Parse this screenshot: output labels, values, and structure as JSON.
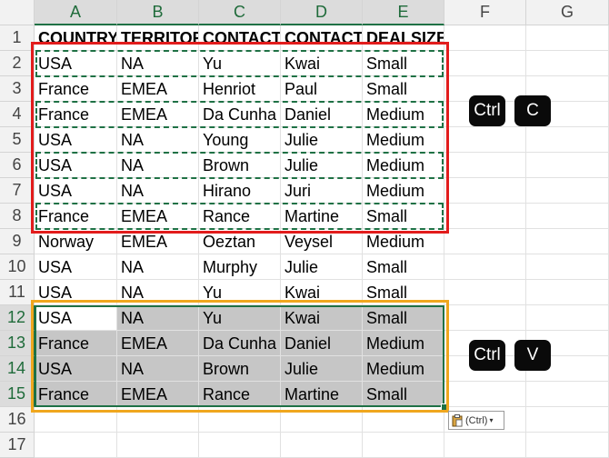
{
  "columns": [
    "A",
    "B",
    "C",
    "D",
    "E",
    "F",
    "G"
  ],
  "rows": [
    "1",
    "2",
    "3",
    "4",
    "5",
    "6",
    "7",
    "8",
    "9",
    "10",
    "11",
    "12",
    "13",
    "14",
    "15",
    "16",
    "17"
  ],
  "header_row": [
    "COUNTRY",
    "TERRITORY",
    "CONTACTLASTNAME",
    "CONTACTFIRSTNAME",
    "DEALSIZE"
  ],
  "data_rows": [
    [
      "USA",
      "NA",
      "Yu",
      "Kwai",
      "Small"
    ],
    [
      "France",
      "EMEA",
      "Henriot",
      "Paul",
      "Small"
    ],
    [
      "France",
      "EMEA",
      "Da Cunha",
      "Daniel",
      "Medium"
    ],
    [
      "USA",
      "NA",
      "Young",
      "Julie",
      "Medium"
    ],
    [
      "USA",
      "NA",
      "Brown",
      "Julie",
      "Medium"
    ],
    [
      "USA",
      "NA",
      "Hirano",
      "Juri",
      "Medium"
    ],
    [
      "France",
      "EMEA",
      "Rance",
      "Martine",
      "Small"
    ],
    [
      "Norway",
      "EMEA",
      "Oeztan",
      "Veysel",
      "Medium"
    ],
    [
      "USA",
      "NA",
      "Murphy",
      "Julie",
      "Small"
    ],
    [
      "USA",
      "NA",
      "Yu",
      "Kwai",
      "Small"
    ],
    [
      "USA",
      "NA",
      "Yu",
      "Kwai",
      "Small"
    ],
    [
      "France",
      "EMEA",
      "Da Cunha",
      "Daniel",
      "Medium"
    ],
    [
      "USA",
      "NA",
      "Brown",
      "Julie",
      "Medium"
    ],
    [
      "France",
      "EMEA",
      "Rance",
      "Martine",
      "Small"
    ]
  ],
  "copy_shortcut": {
    "ctrl_label": "Ctrl",
    "key_label": "C"
  },
  "paste_shortcut": {
    "ctrl_label": "Ctrl",
    "key_label": "V"
  },
  "paste_options_label": "(Ctrl)",
  "colors": {
    "copy_highlight": "#e21c1c",
    "paste_highlight": "#f0a71e",
    "excel_green": "#1f7145",
    "selection_fill": "#c6c6c6"
  }
}
